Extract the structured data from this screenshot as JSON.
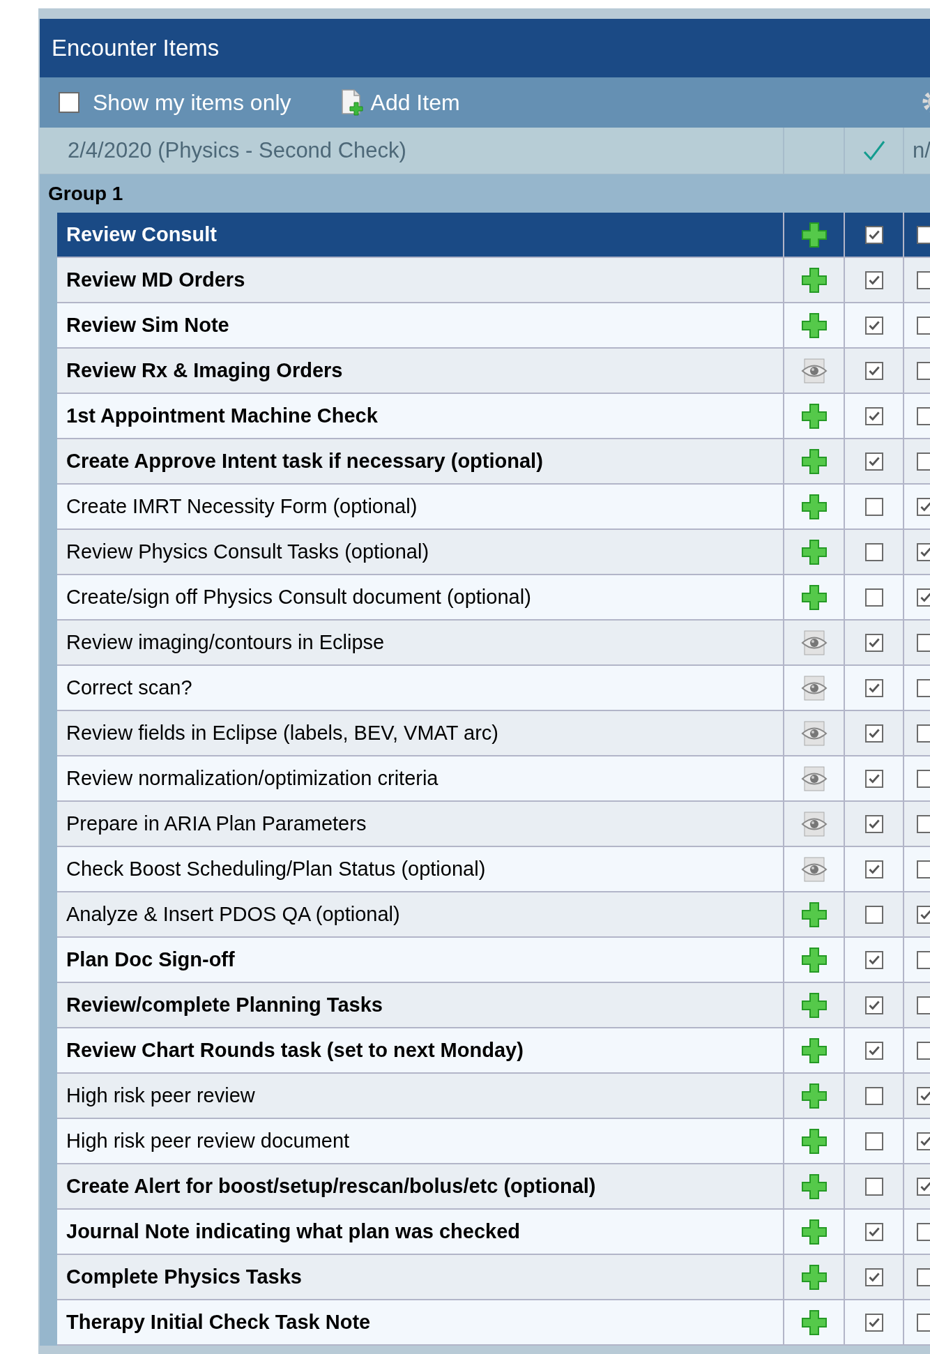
{
  "panel": {
    "title": "Encounter Items"
  },
  "toolbar": {
    "show_mine": {
      "label": "Show my items only",
      "checked": false
    },
    "add_item": "Add Item"
  },
  "encounter": {
    "date_label": "2/4/2020 (Physics - Second Check)",
    "column_3": "n/"
  },
  "group": {
    "label": "Group 1"
  },
  "items": [
    {
      "label": "Review Consult",
      "bold": true,
      "selected": true,
      "kind": "add",
      "done": true,
      "na": false
    },
    {
      "label": "Review MD Orders",
      "bold": true,
      "selected": false,
      "kind": "add",
      "done": true,
      "na": false
    },
    {
      "label": "Review Sim Note",
      "bold": true,
      "selected": false,
      "kind": "add",
      "done": true,
      "na": false
    },
    {
      "label": "Review Rx & Imaging Orders",
      "bold": true,
      "selected": false,
      "kind": "view",
      "done": true,
      "na": false
    },
    {
      "label": "1st Appointment Machine Check",
      "bold": true,
      "selected": false,
      "kind": "add",
      "done": true,
      "na": false
    },
    {
      "label": "Create Approve Intent task if necessary (optional)",
      "bold": true,
      "selected": false,
      "kind": "add",
      "done": true,
      "na": false
    },
    {
      "label": "Create IMRT Necessity Form (optional)",
      "bold": false,
      "selected": false,
      "kind": "add",
      "done": false,
      "na": true
    },
    {
      "label": "Review Physics Consult Tasks (optional)",
      "bold": false,
      "selected": false,
      "kind": "add",
      "done": false,
      "na": true
    },
    {
      "label": "Create/sign off Physics Consult document (optional)",
      "bold": false,
      "selected": false,
      "kind": "add",
      "done": false,
      "na": true
    },
    {
      "label": "Review imaging/contours in Eclipse",
      "bold": false,
      "selected": false,
      "kind": "view",
      "done": true,
      "na": false
    },
    {
      "label": "Correct scan?",
      "bold": false,
      "selected": false,
      "kind": "view",
      "done": true,
      "na": false
    },
    {
      "label": "Review fields in Eclipse (labels, BEV, VMAT arc)",
      "bold": false,
      "selected": false,
      "kind": "view",
      "done": true,
      "na": false
    },
    {
      "label": "Review normalization/optimization criteria",
      "bold": false,
      "selected": false,
      "kind": "view",
      "done": true,
      "na": false
    },
    {
      "label": "Prepare in ARIA Plan Parameters",
      "bold": false,
      "selected": false,
      "kind": "view",
      "done": true,
      "na": false
    },
    {
      "label": "Check Boost Scheduling/Plan Status (optional)",
      "bold": false,
      "selected": false,
      "kind": "view",
      "done": true,
      "na": false
    },
    {
      "label": "Analyze & Insert PDOS QA (optional)",
      "bold": false,
      "selected": false,
      "kind": "add",
      "done": false,
      "na": true
    },
    {
      "label": "Plan Doc Sign-off",
      "bold": true,
      "selected": false,
      "kind": "add",
      "done": true,
      "na": false
    },
    {
      "label": "Review/complete Planning Tasks",
      "bold": true,
      "selected": false,
      "kind": "add",
      "done": true,
      "na": false
    },
    {
      "label": "Review Chart Rounds task (set to next Monday)",
      "bold": true,
      "selected": false,
      "kind": "add",
      "done": true,
      "na": false
    },
    {
      "label": "High risk peer review",
      "bold": false,
      "selected": false,
      "kind": "add",
      "done": false,
      "na": true
    },
    {
      "label": "High risk peer review document",
      "bold": false,
      "selected": false,
      "kind": "add",
      "done": false,
      "na": true
    },
    {
      "label": "Create Alert for boost/setup/rescan/bolus/etc (optional)",
      "bold": true,
      "selected": false,
      "kind": "add",
      "done": false,
      "na": true
    },
    {
      "label": "Journal Note indicating what plan was checked",
      "bold": true,
      "selected": false,
      "kind": "add",
      "done": true,
      "na": false
    },
    {
      "label": "Complete Physics Tasks",
      "bold": true,
      "selected": false,
      "kind": "add",
      "done": true,
      "na": false
    },
    {
      "label": "Therapy Initial Check Task Note",
      "bold": true,
      "selected": false,
      "kind": "add",
      "done": true,
      "na": false
    }
  ]
}
